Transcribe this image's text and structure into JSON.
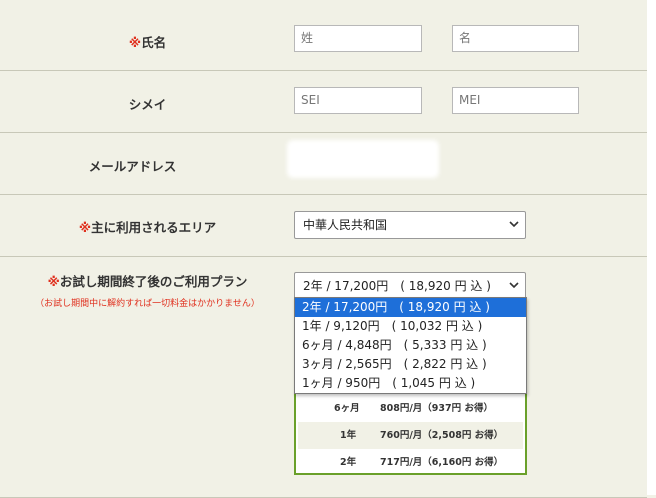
{
  "fields": {
    "name": {
      "required_mark": "※",
      "label": "氏名",
      "last_placeholder": "姓",
      "first_placeholder": "名"
    },
    "kana": {
      "label": "シメイ",
      "last_placeholder": "SEI",
      "first_placeholder": "MEI"
    },
    "email": {
      "label": "メールアドレス"
    },
    "area": {
      "required_mark": "※",
      "label": "主に利用されるエリア",
      "value": "中華人民共和国"
    },
    "plan": {
      "required_mark": "※",
      "label": "お試し期間終了後のご利用プラン",
      "note": "（お試し期間中に解約すれば一切料金はかかりません）",
      "value": "2年 / 17,200円　( 18,920 円 込 )",
      "options": [
        "2年 / 17,200円　( 18,920 円 込 )",
        "1年 / 9,120円　( 10,032 円 込 )",
        "6ヶ月 / 4,848円　( 5,333 円 込 )",
        "3ヶ月 / 2,565円　( 2,822 円 込 )",
        "1ヶ月 / 950円　( 1,045 円 込 )"
      ],
      "selected_index": 0
    }
  },
  "plan_table": [
    {
      "term": "6ヶ月",
      "price": "808円/月（937円  お得）"
    },
    {
      "term": "1年",
      "price": "760円/月（2,508円  お得）"
    },
    {
      "term": "2年",
      "price": "717円/月（6,160円  お得）"
    }
  ],
  "colors": {
    "background": "#f1f1e6",
    "required": "#e0301e",
    "highlight": "#1e6fd9",
    "table_border": "#6aa02a"
  },
  "icons": {
    "select_arrow": "chevron-down-icon"
  }
}
